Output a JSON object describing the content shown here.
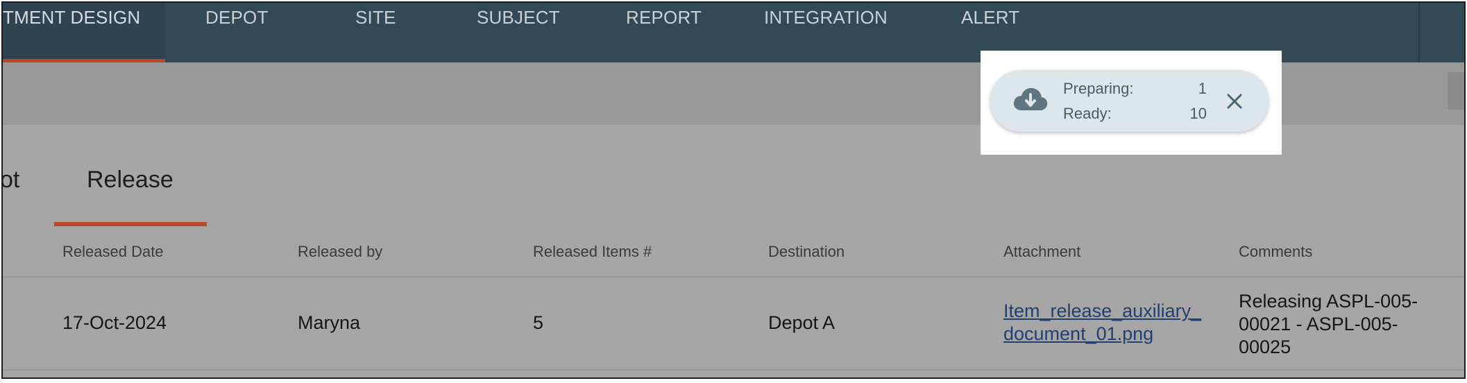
{
  "nav": {
    "items": [
      "TMENT DESIGN",
      "DEPOT",
      "SITE",
      "SUBJECT",
      "REPORT",
      "INTEGRATION",
      "ALERT"
    ],
    "active_index": 0
  },
  "tabs": {
    "partial": "ot",
    "active": "Release"
  },
  "table": {
    "headers": [
      "Released Date",
      "Released by",
      "Released Items #",
      "Destination",
      "Attachment",
      "Comments"
    ],
    "row": {
      "date": "17-Oct-2024",
      "by": "Maryna",
      "items": "5",
      "destination": "Depot A",
      "attachment_l1": "Item_release_auxiliary_",
      "attachment_l2": "document_01.png",
      "comment_l1": "Releasing ASPL-005-",
      "comment_l2": "00021 - ASPL-005-",
      "comment_l3": "00025"
    }
  },
  "download_popup": {
    "preparing_label": "Preparing:",
    "preparing_count": "1",
    "ready_label": "Ready:",
    "ready_count": "10",
    "icon": "cloud-download-icon",
    "close_icon": "close-icon"
  },
  "colors": {
    "nav_bg": "#334a56",
    "accent": "#b9472a",
    "link": "#21406f",
    "popup_bg": "#dde6eb"
  }
}
